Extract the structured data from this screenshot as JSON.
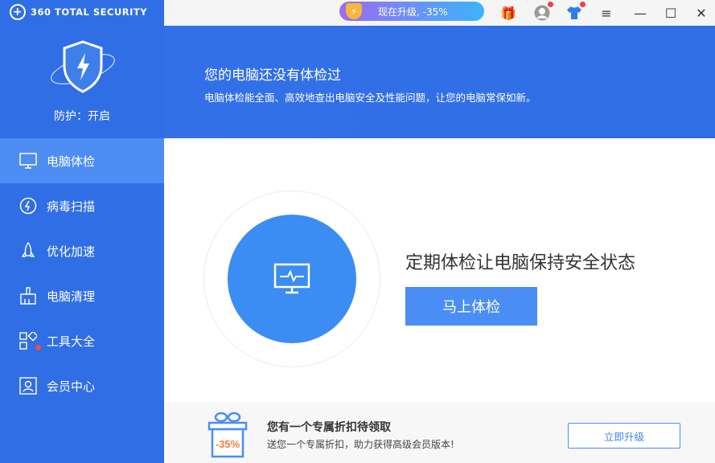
{
  "app": {
    "title": "360 TOTAL SECURITY"
  },
  "titlebar": {
    "promo_label": "现在升级, -35%"
  },
  "sidebar": {
    "protection_status": "防护：开启",
    "items": [
      {
        "label": "电脑体检"
      },
      {
        "label": "病毒扫描"
      },
      {
        "label": "优化加速"
      },
      {
        "label": "电脑清理"
      },
      {
        "label": "工具大全"
      },
      {
        "label": "会员中心"
      }
    ]
  },
  "banner": {
    "title": "您的电脑还没有体检过",
    "subtitle": "电脑体检能全面、高效地查出电脑安全及性能问题，让您的电脑常保如新。"
  },
  "main": {
    "slogan": "定期体检让电脑保持安全状态",
    "check_button": "马上体检"
  },
  "bottom": {
    "discount": "-35%",
    "title": "您有一个专属折扣待领取",
    "subtitle": "送您一个专属折扣，助力获得高级会员版本!",
    "upgrade_button": "立即升级"
  },
  "colors": {
    "sidebar": "#2f6ee5",
    "accent": "#4a8ef5",
    "active": "#4d8cf2"
  }
}
